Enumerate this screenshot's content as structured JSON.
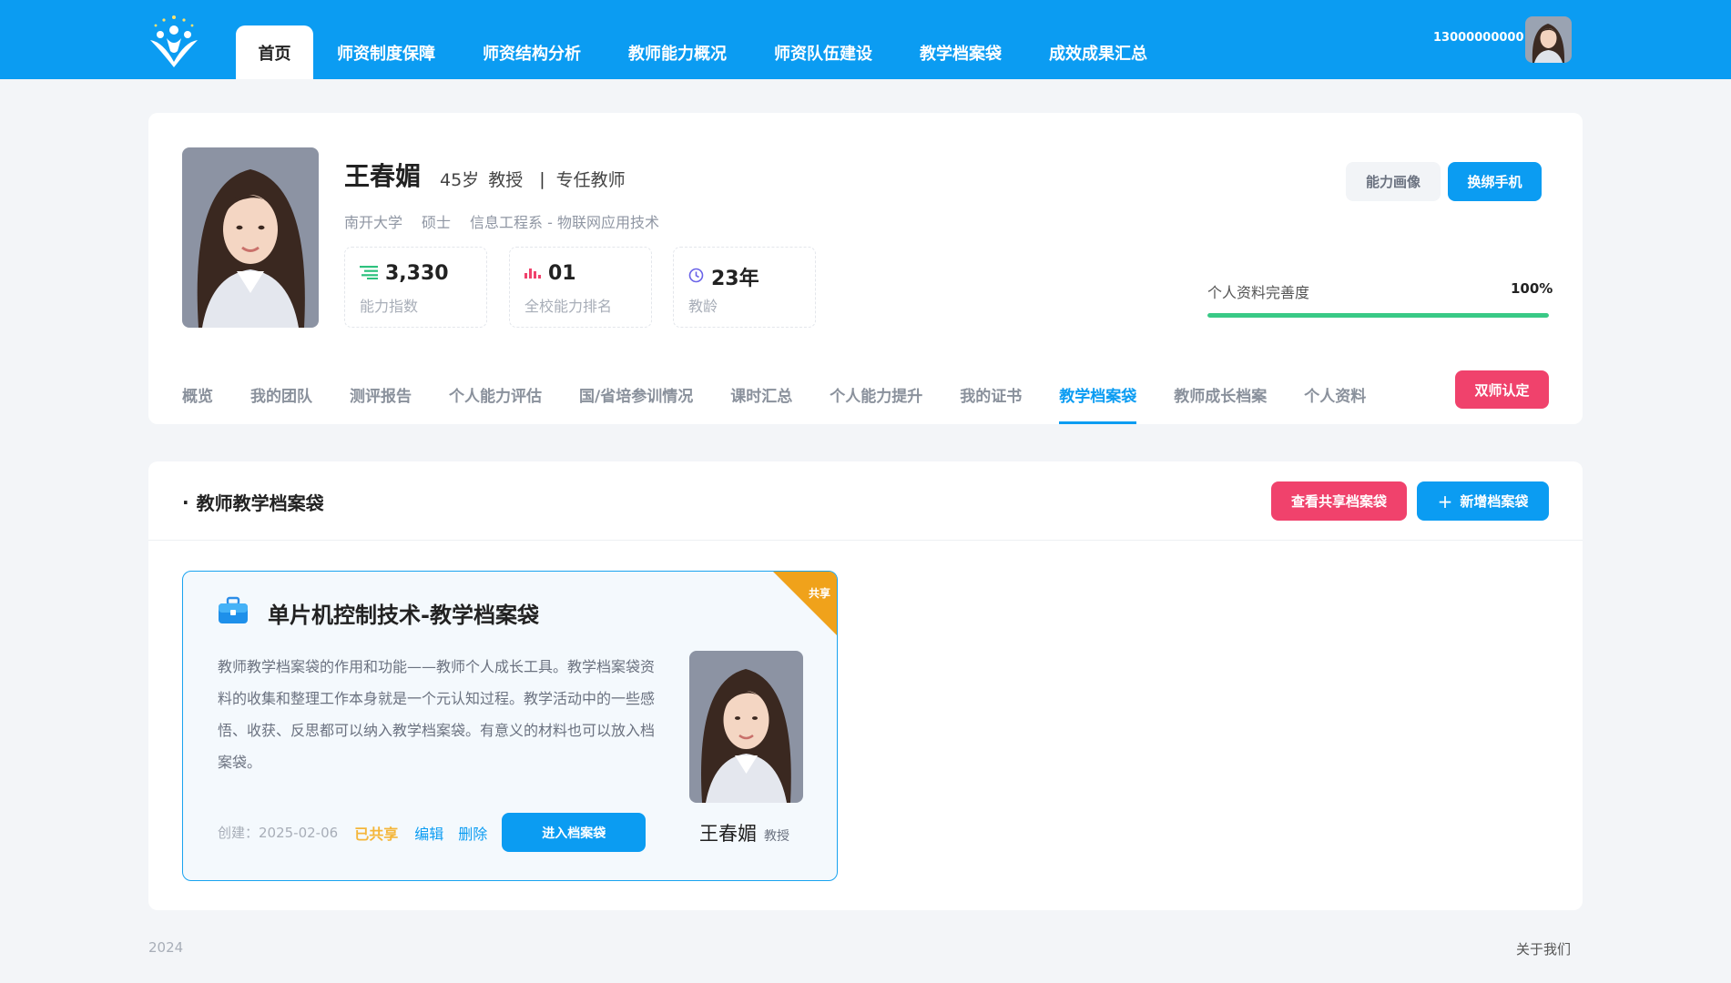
{
  "nav": {
    "items": [
      "首页",
      "师资制度保障",
      "师资结构分析",
      "教师能力概况",
      "师资队伍建设",
      "教学档案袋",
      "成效成果汇总"
    ],
    "active_index": 0,
    "user_phone": "13000000000"
  },
  "profile": {
    "name": "王春媚",
    "age": "45岁",
    "title": "教授",
    "role": "专任教师",
    "school": "南开大学",
    "degree": "硕士",
    "department": "信息工程系 - 物联网应用技术",
    "stats": [
      {
        "icon": "ability-icon",
        "value": "3,330",
        "label": "能力指数"
      },
      {
        "icon": "rank-chart-icon",
        "value": "01",
        "label": "全校能力排名"
      },
      {
        "icon": "clock-icon",
        "value": "23年",
        "label": "教龄"
      }
    ],
    "btn_portrait": "能力画像",
    "btn_rebind": "换绑手机",
    "completeness_label": "个人资料完善度",
    "completeness_value": "100%",
    "completeness_fraction": 1.0,
    "tabs": [
      "概览",
      "我的团队",
      "测评报告",
      "个人能力评估",
      "国/省培参训情况",
      "课时汇总",
      "个人能力提升",
      "我的证书",
      "教学档案袋",
      "教师成长档案",
      "个人资料"
    ],
    "active_tab_index": 8,
    "btn_dual": "双师认定"
  },
  "section": {
    "title": "教师教学档案袋",
    "btn_view_shared": "查看共享档案袋",
    "btn_add": "新增档案袋",
    "add_icon": "+"
  },
  "portfolio": {
    "corner_label": "共享",
    "title": "单片机控制技术-教学档案袋",
    "description": "教师教学档案袋的作用和功能——教师个人成长工具。教学档案袋资料的收集和整理工作本身就是一个元认知过程。教学活动中的一些感悟、收获、反思都可以纳入教学档案袋。有意义的材料也可以放入档案袋。",
    "created": "创建：2025-02-06",
    "shared_status": "已共享",
    "edit": "编辑",
    "delete": "删除",
    "btn_enter": "进入档案袋",
    "owner_name": "王春媚",
    "owner_title": "教授"
  },
  "footer": {
    "year": "2024",
    "about": "关于我们"
  },
  "colors": {
    "primary": "#0b9cf2",
    "danger": "#f0426c",
    "success": "#39c986",
    "corner": "#f0a21b",
    "shared_text": "#f4b63a"
  }
}
